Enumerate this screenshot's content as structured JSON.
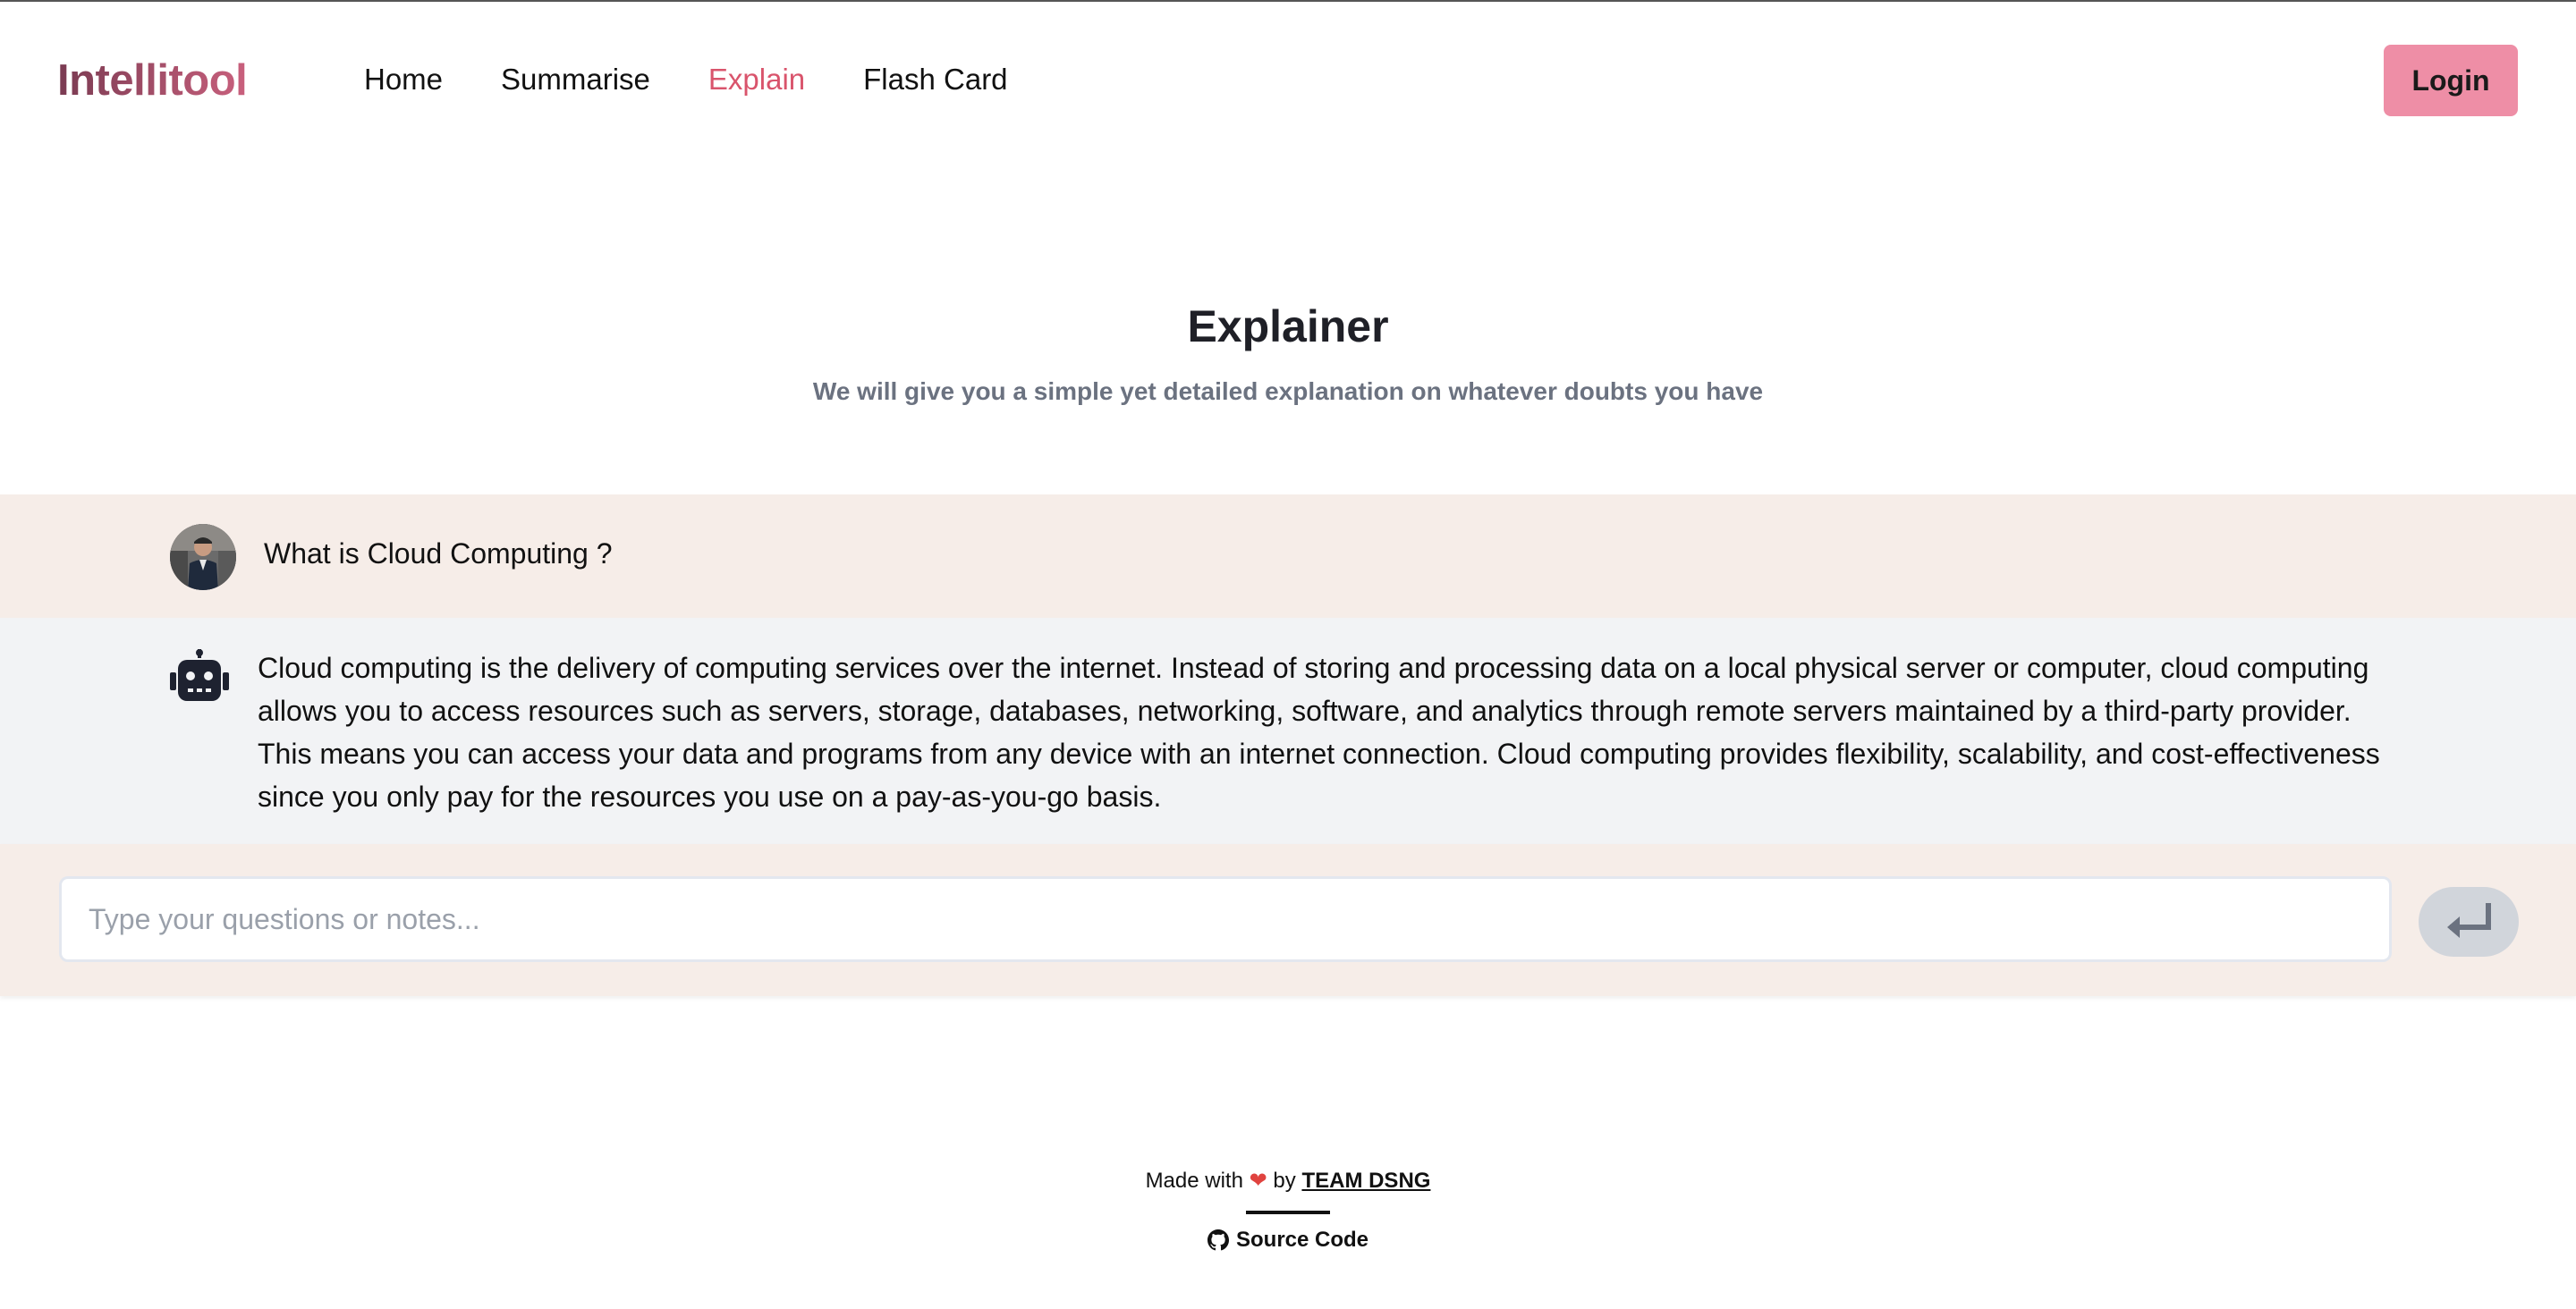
{
  "header": {
    "brand": "Intellitool",
    "nav": [
      {
        "label": "Home",
        "active": false
      },
      {
        "label": "Summarise",
        "active": false
      },
      {
        "label": "Explain",
        "active": true
      },
      {
        "label": "Flash Card",
        "active": false
      }
    ],
    "login_label": "Login"
  },
  "hero": {
    "title": "Explainer",
    "subtitle": "We will give you a simple yet detailed explanation on whatever doubts you have"
  },
  "chat": {
    "user_message": "What is Cloud Computing ?",
    "bot_response": "Cloud computing is the delivery of computing services over the internet. Instead of storing and processing data on a local physical server or computer, cloud computing allows you to access resources such as servers, storage, databases, networking, software, and analytics through remote servers maintained by a third-party provider. This means you can access your data and programs from any device with an internet connection. Cloud computing provides flexibility, scalability, and cost-effectiveness since you only pay for the resources you use on a pay-as-you-go basis.",
    "user_avatar_icon": "user-avatar",
    "bot_icon": "robot-icon"
  },
  "input": {
    "placeholder": "Type your questions or notes...",
    "value": "",
    "send_icon": "enter-arrow-icon"
  },
  "footer": {
    "made_with": "Made with",
    "heart": "❤",
    "by": "by",
    "team": "TEAM DSNG",
    "source": "Source Code",
    "source_icon": "github-icon"
  },
  "colors": {
    "accent_pink": "#ee8ea6",
    "active_nav": "#d9546c",
    "user_row_bg": "#f6ede8",
    "bot_row_bg": "#f2f3f5"
  }
}
